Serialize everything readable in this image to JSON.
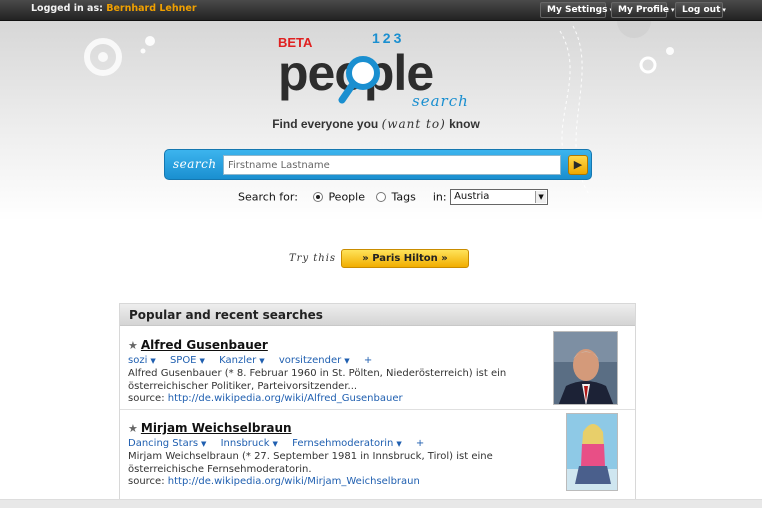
{
  "topbar": {
    "logged_in_label": "Logged in as:",
    "username": "Bernhard Lehner",
    "settings_label": "My Settings",
    "profile_label": "My Profile",
    "logout_label": "Log out"
  },
  "logo": {
    "beta": "BETA",
    "word": "people",
    "numbers": "123",
    "search_word": "search"
  },
  "tagline": {
    "before": "Find everyone you",
    "script": "(want to)",
    "after": "know"
  },
  "search": {
    "label": "search",
    "placeholder": "Firstname Lastname",
    "go_icon": "arrow-right"
  },
  "search_for": {
    "label": "Search for:",
    "option_people": "People",
    "option_tags": "Tags",
    "selected": "People",
    "in_label": "in:",
    "country": "Austria"
  },
  "try": {
    "label": "Try this",
    "button": "» Paris Hilton »"
  },
  "popular": {
    "heading": "Popular and recent searches",
    "entries": [
      {
        "name": "Alfred Gusenbauer",
        "tags": [
          "sozi",
          "SPOE",
          "Kanzler",
          "vorsitzender"
        ],
        "add": "+",
        "description": "Alfred Gusenbauer (* 8. Februar 1960 in St. Pölten, Niederösterreich) ist ein österreichischer Politiker, Parteivorsitzender...",
        "source_label": "source:",
        "source_url": "http://de.wikipedia.org/wiki/Alfred_Gusenbauer"
      },
      {
        "name": "Mirjam Weichselbraun",
        "tags": [
          "Dancing Stars",
          "Innsbruck",
          "Fernsehmoderatorin"
        ],
        "add": "+",
        "description": "Mirjam Weichselbraun (* 27. September 1981 in Innsbruck, Tirol) ist eine österreichische Fernsehmoderatorin.",
        "source_label": "source:",
        "source_url": "http://de.wikipedia.org/wiki/Mirjam_Weichselbraun"
      }
    ]
  },
  "colors": {
    "accent_blue": "#1a8fd0",
    "accent_yellow": "#f1ad00",
    "link_blue": "#1f5fb0",
    "username_orange": "#f0a000"
  }
}
